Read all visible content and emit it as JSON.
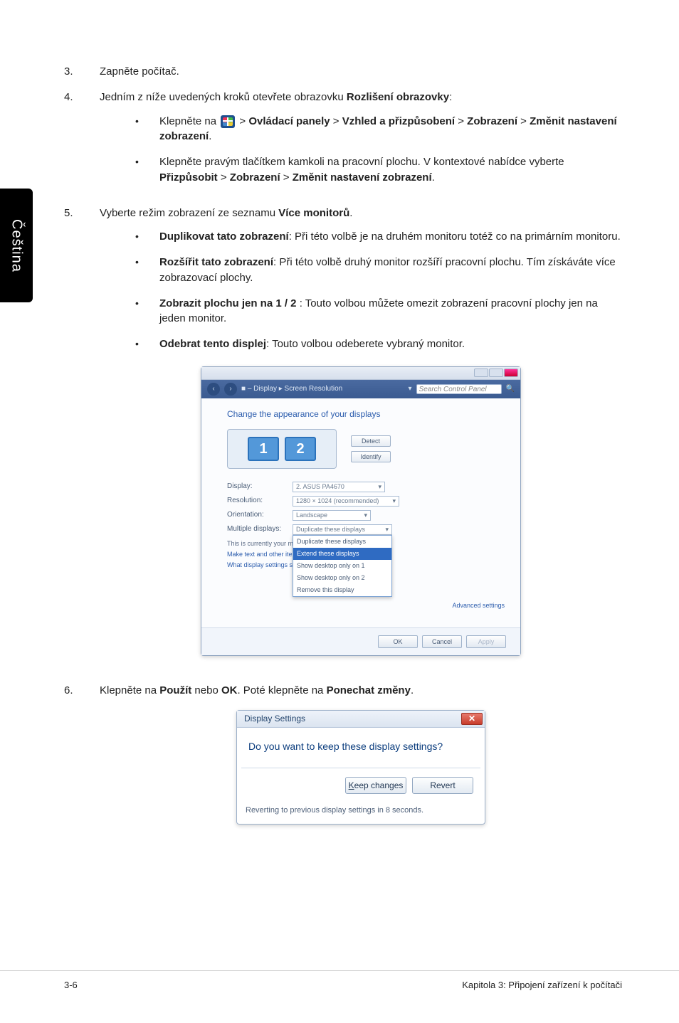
{
  "lang_tab": "Čeština",
  "steps": {
    "s3": {
      "num": "3.",
      "text": "Zapněte počítač."
    },
    "s4": {
      "num": "4.",
      "intro_a": "Jedním z níže uvedených kroků otevřete obrazovku ",
      "intro_b": "Rozlišení obrazovky",
      "intro_c": ":",
      "b1_a": "Klepněte na ",
      "b1_b": " > ",
      "b1_c": "Ovládací panely",
      "b1_d": " > ",
      "b1_e": "Vzhled a přizpůsobení",
      "b1_f": " > ",
      "b1_g": "Zobrazení",
      "b1_h": " > ",
      "b1_i": "Změnit nastavení zobrazení",
      "b1_j": ".",
      "b2_a": "Klepněte pravým tlačítkem kamkoli na pracovní plochu. V kontextové nabídce vyberte ",
      "b2_b": "Přizpůsobit",
      "b2_c": " > ",
      "b2_d": "Zobrazení",
      "b2_e": " > ",
      "b2_f": "Změnit nastavení zobrazení",
      "b2_g": "."
    },
    "s5": {
      "num": "5.",
      "intro_a": "Vyberte režim zobrazení ze seznamu ",
      "intro_b": "Více monitorů",
      "intro_c": ".",
      "o1_a": "Duplikovat tato zobrazení",
      "o1_b": ": Při této volbě je na druhém monitoru totéž co na primárním monitoru.",
      "o2_a": "Rozšířit tato zobrazení",
      "o2_b": ": Při této volbě druhý monitor rozšíří pracovní plochu. Tím získáváte více zobrazovací plochy.",
      "o3_a": "Zobrazit plochu jen na 1 / 2",
      "o3_b": " : Touto volbou můžete omezit zobrazení pracovní plochy jen na jeden monitor.",
      "o4_a": "Odebrat tento displej",
      "o4_b": ": Touto volbou odeberete vybraný monitor."
    },
    "s6": {
      "num": "6.",
      "a": "Klepněte na ",
      "b": "Použít",
      "c": " nebo ",
      "d": "OK",
      "e": ". Poté klepněte na ",
      "f": "Ponechat změny",
      "g": "."
    }
  },
  "dlg1": {
    "crumb": "■ – Display ▸ Screen Resolution",
    "search": "Search Control Panel",
    "heading": "Change the appearance of your displays",
    "mon1": "1",
    "mon2": "2",
    "detect": "Detect",
    "identify": "Identify",
    "labels": {
      "display": "Display:",
      "resolution": "Resolution:",
      "orientation": "Orientation:",
      "multi": "Multiple displays:"
    },
    "values": {
      "display": "2. ASUS PA4670",
      "resolution": "1280 × 1024 (recommended)",
      "orientation": "Landscape",
      "multi": "Duplicate these displays"
    },
    "dd": {
      "o1": "Duplicate these displays",
      "o2": "Extend these displays",
      "o3": "Show desktop only on 1",
      "o4": "Show desktop only on 2",
      "o5": "Remove this display"
    },
    "hint1": "This is currently your main display.",
    "hint2": "Make text and other items larger or smaller",
    "hint3": "What display settings should I choose?",
    "adv": "Advanced settings",
    "ok": "OK",
    "cancel": "Cancel",
    "apply": "Apply"
  },
  "dlg2": {
    "title": "Display Settings",
    "question": "Do you want to keep these display settings?",
    "keep": "Keep changes",
    "revert": "Revert",
    "countdown": "Reverting to previous display settings in 8 seconds."
  },
  "footer": {
    "page": "3-6",
    "chapter": "Kapitola 3: Připojení zařízení k počítači"
  }
}
